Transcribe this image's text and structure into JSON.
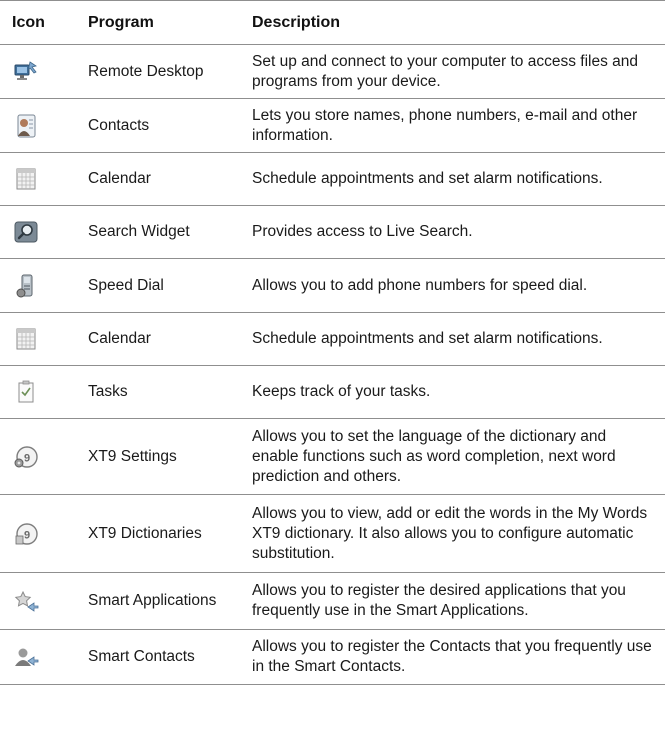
{
  "header": {
    "icon": "Icon",
    "program": "Program",
    "description": "Description"
  },
  "rows": [
    {
      "icon": "remote-desktop-icon",
      "program": "Remote Desktop",
      "description": "Set up and connect to your computer to access files and programs from your device."
    },
    {
      "icon": "contacts-icon",
      "program": "Contacts",
      "description": "Lets you store names, phone numbers, e-mail and other information."
    },
    {
      "icon": "calendar-icon",
      "program": "Calendar",
      "description": "Schedule appointments and set alarm notifications."
    },
    {
      "icon": "search-widget-icon",
      "program": "Search Widget",
      "description": "Provides access to Live Search."
    },
    {
      "icon": "speed-dial-icon",
      "program": "Speed Dial",
      "description": "Allows you to add phone numbers for speed dial."
    },
    {
      "icon": "calendar-icon",
      "program": "Calendar",
      "description": "Schedule appointments and set alarm notifications."
    },
    {
      "icon": "tasks-icon",
      "program": "Tasks",
      "description": "Keeps track of your tasks."
    },
    {
      "icon": "xt9-settings-icon",
      "program": "XT9 Settings",
      "description": "Allows you to set the language of the dictionary and enable functions such as word completion, next word prediction and others."
    },
    {
      "icon": "xt9-dictionaries-icon",
      "program": "XT9 Dictionaries",
      "description": "Allows you to view, add or edit the words in the My Words XT9 dictionary. It also allows you to configure automatic substitution."
    },
    {
      "icon": "smart-applications-icon",
      "program": "Smart Applications",
      "description": "Allows you to register the desired applications that you frequently use in the Smart Applications."
    },
    {
      "icon": "smart-contacts-icon",
      "program": "Smart Contacts",
      "description": "Allows you to register the Contacts that you frequently use in the Smart Contacts."
    }
  ]
}
